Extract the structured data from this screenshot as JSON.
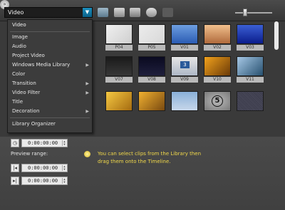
{
  "toolbar": {
    "category_value": "Video",
    "dropdown_arrow_icon": "chevron-down-icon",
    "icons": [
      "folder-icon",
      "import-icon",
      "list-view-icon",
      "refresh-icon",
      "disabled-icon",
      "more-options-icon"
    ]
  },
  "dropdown": {
    "items": [
      {
        "label": "Video",
        "submenu": false
      },
      {
        "label": "Image",
        "submenu": false
      },
      {
        "label": "Audio",
        "submenu": false
      },
      {
        "label": "Project Video",
        "submenu": false
      },
      {
        "label": "Windows Media Library",
        "submenu": true
      },
      {
        "label": "Color",
        "submenu": false
      },
      {
        "label": "Transition",
        "submenu": true
      },
      {
        "label": "Video Filter",
        "submenu": true
      },
      {
        "label": "Title",
        "submenu": false
      },
      {
        "label": "Decoration",
        "submenu": true
      },
      {
        "label": "Library Organizer",
        "submenu": false
      }
    ],
    "submenu_glyph": "▶"
  },
  "thumbnails": {
    "row1": [
      "P04",
      "P05",
      "V01",
      "V02",
      "V03"
    ],
    "row2": [
      "V07",
      "V08",
      "V09",
      "V10",
      "V11"
    ]
  },
  "counter_digit": "5",
  "monitor_digit": "3",
  "bottom": {
    "timecode_current": "0:00:00:00",
    "preview_range_label": "Preview range:",
    "timecode_start": "0:00:00:00",
    "timecode_end": "0:00:00:00",
    "hint": "You can select clips from the Library then drag them onto the Timeline."
  },
  "colors": {
    "hint_text": "#f1d84a",
    "combo_accent": "#1b8fbf"
  }
}
